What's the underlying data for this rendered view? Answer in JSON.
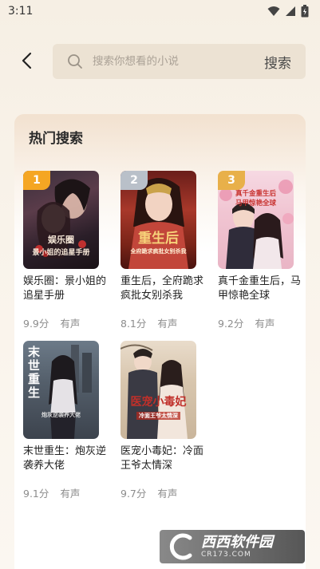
{
  "status_bar": {
    "time": "3:11"
  },
  "search": {
    "placeholder": "搜索你想看的小说",
    "button_label": "搜索"
  },
  "section_title": "热门搜索",
  "books": [
    {
      "rank": "1",
      "name": "娱乐圈：景小姐的追星手册",
      "score": "9.9分",
      "audio": "有声",
      "cover_title": "娱乐圈",
      "cover_subtitle": "景小姐的追星手册",
      "rank_color": "#f5a623"
    },
    {
      "rank": "2",
      "name": "重生后，全府跪求疯批女别杀我",
      "score": "8.1分",
      "audio": "有声",
      "cover_title": "重生后",
      "cover_subtitle": "全府跪求疯批女别杀我",
      "rank_color": "#b9c0c9"
    },
    {
      "rank": "3",
      "name": "真千金重生后，马甲惊艳全球",
      "score": "9.2分",
      "audio": "有声",
      "cover_title": "真千金重生后",
      "cover_subtitle": "马甲惊艳全球",
      "rank_color": "#e8b04a"
    },
    {
      "rank": "",
      "name": "末世重生：炮灰逆袭养大佬",
      "score": "9.1分",
      "audio": "有声",
      "cover_title": "末世重生",
      "cover_subtitle": "炮灰逆袭养大佬"
    },
    {
      "rank": "",
      "name": "医宠小毒妃：冷面王爷太情深",
      "score": "9.7分",
      "audio": "有声",
      "cover_title": "医宠小毒妃",
      "cover_subtitle": "冷面王爷太情深"
    }
  ],
  "watermark": {
    "text": "西西软件园",
    "url": "CR173.COM"
  }
}
